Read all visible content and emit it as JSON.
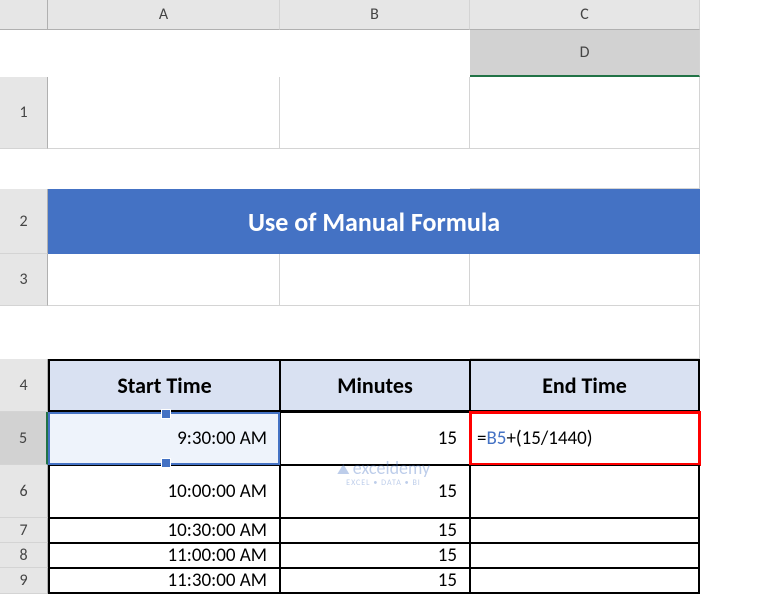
{
  "columns": [
    "A",
    "B",
    "C",
    "D"
  ],
  "rows": [
    "1",
    "2",
    "3",
    "4",
    "5",
    "6",
    "7",
    "8",
    "9"
  ],
  "title": "Use of Manual Formula",
  "headers": {
    "b": "Start Time",
    "c": "Minutes",
    "d": "End Time"
  },
  "table": [
    {
      "start": "9:30:00 AM",
      "minutes": "15",
      "end": ""
    },
    {
      "start": "10:00:00 AM",
      "minutes": "15",
      "end": ""
    },
    {
      "start": "10:30:00 AM",
      "minutes": "15",
      "end": ""
    },
    {
      "start": "11:00:00 AM",
      "minutes": "15",
      "end": ""
    },
    {
      "start": "11:30:00 AM",
      "minutes": "15",
      "end": ""
    }
  ],
  "formula": {
    "eq": "=",
    "ref": "B5",
    "rest": "+(15/1440)"
  },
  "watermark": {
    "name": "exceldemy",
    "tagline": "EXCEL • DATA • BI"
  },
  "chart_data": {
    "type": "table",
    "title": "Use of Manual Formula",
    "columns": [
      "Start Time",
      "Minutes",
      "End Time"
    ],
    "rows": [
      [
        "9:30:00 AM",
        15,
        "=B5+(15/1440)"
      ],
      [
        "10:00:00 AM",
        15,
        ""
      ],
      [
        "10:30:00 AM",
        15,
        ""
      ],
      [
        "11:00:00 AM",
        15,
        ""
      ],
      [
        "11:30:00 AM",
        15,
        ""
      ]
    ]
  }
}
